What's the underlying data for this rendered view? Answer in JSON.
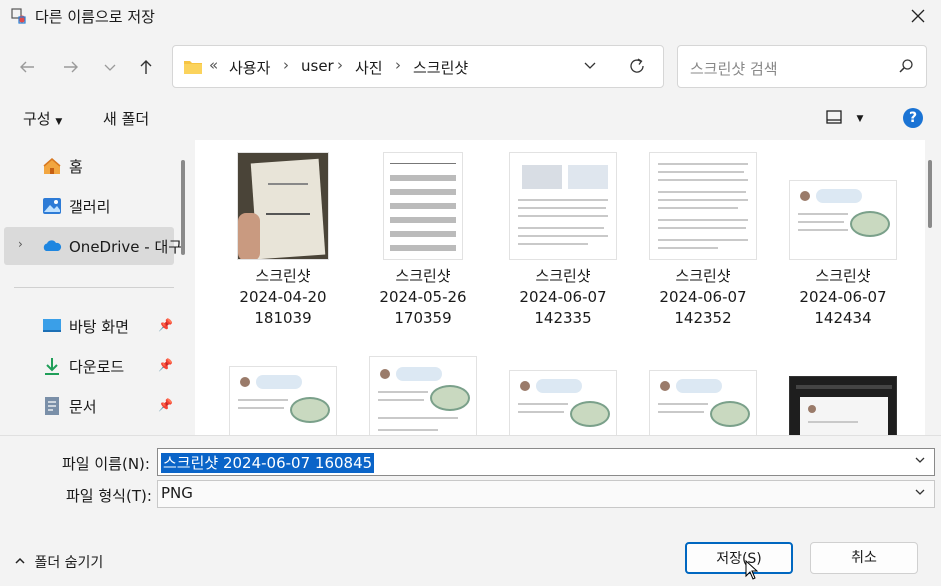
{
  "window": {
    "title": "다른 이름으로 저장"
  },
  "address": {
    "overflow": "«",
    "crumbs": [
      "사용자",
      "user",
      "사진",
      "스크린샷"
    ]
  },
  "search": {
    "placeholder": "스크린샷 검색"
  },
  "toolbar": {
    "organize": "구성",
    "new_folder": "새 폴더",
    "help": "?"
  },
  "nav": {
    "items": [
      {
        "label": "홈",
        "icon": "home-icon"
      },
      {
        "label": "갤러리",
        "icon": "gallery-icon"
      },
      {
        "label": "OneDrive - 대구",
        "icon": "onedrive-icon"
      },
      {
        "label": "바탕 화면",
        "icon": "desktop-icon"
      },
      {
        "label": "다운로드",
        "icon": "download-icon"
      },
      {
        "label": "문서",
        "icon": "documents-icon"
      }
    ]
  },
  "files": [
    {
      "name": "스크린샷",
      "date": "2024-04-20",
      "time": "181039"
    },
    {
      "name": "스크린샷",
      "date": "2024-05-26",
      "time": "170359"
    },
    {
      "name": "스크린샷",
      "date": "2024-06-07",
      "time": "142335"
    },
    {
      "name": "스크린샷",
      "date": "2024-06-07",
      "time": "142352"
    },
    {
      "name": "스크린샷",
      "date": "2024-06-07",
      "time": "142434"
    }
  ],
  "form": {
    "filename_label": "파일 이름(N):",
    "filename_value": "스크린샷 2024-06-07 160845",
    "filetype_label": "파일 형식(T):",
    "filetype_value": "PNG"
  },
  "footer": {
    "hide_folders": "폴더 숨기기",
    "save": "저장(S)",
    "cancel": "취소"
  },
  "colors": {
    "accent": "#0067c0",
    "selection": "#0a64c8",
    "help": "#1a73d4"
  }
}
